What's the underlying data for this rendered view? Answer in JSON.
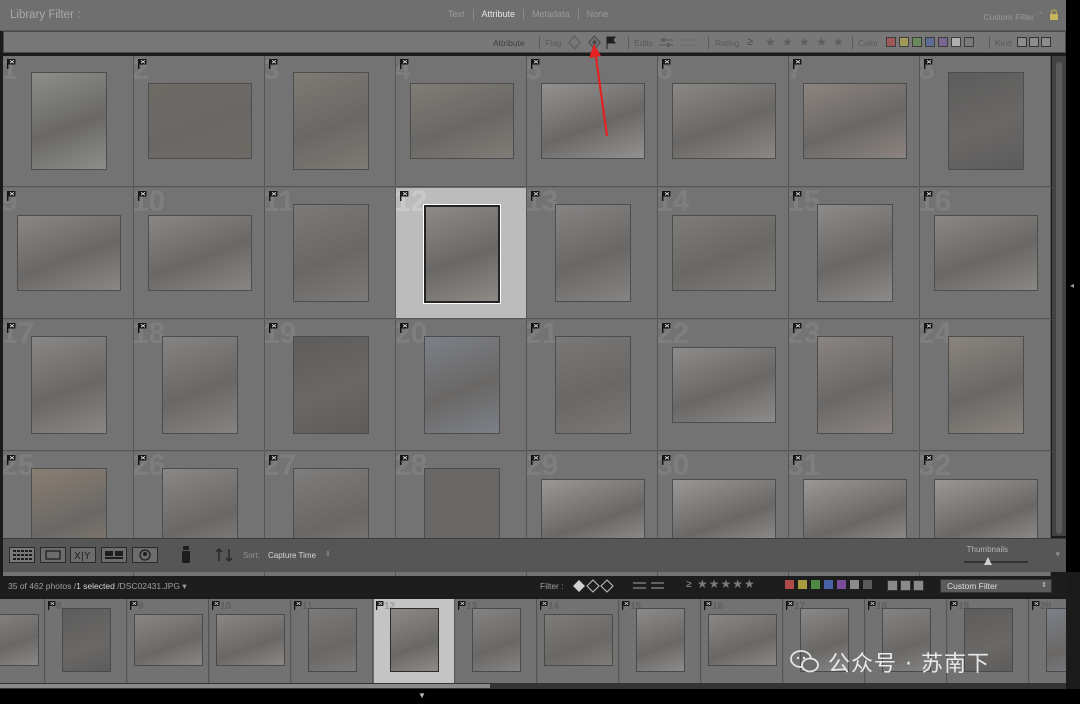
{
  "filter_header": {
    "title": "Library Filter :",
    "tabs": [
      "Text",
      "Attribute",
      "Metadata",
      "None"
    ],
    "active_tab": "Attribute",
    "preset": "Custom Filter",
    "lock_icon": "lock-icon"
  },
  "attribute_bar": {
    "label": "Attribute",
    "flag_label": "Flag",
    "edits_label": "Edits",
    "rating_label": "Rating",
    "rating_op": "≥",
    "color_label": "Color",
    "kind_label": "Kind",
    "colors": [
      "#d05050",
      "#d3c34a",
      "#5aa05a",
      "#5778c4",
      "#9060b4",
      "#e6e6e6",
      "#8a8a8a"
    ]
  },
  "grid": {
    "cells": [
      {
        "n": "1",
        "tone": "#8c8e8a"
      },
      {
        "n": "2",
        "tone": "#6e6a66"
      },
      {
        "n": "3",
        "tone": "#7e7a74"
      },
      {
        "n": "4",
        "tone": "#807c76"
      },
      {
        "n": "5",
        "tone": "#949290"
      },
      {
        "n": "6",
        "tone": "#8a8784"
      },
      {
        "n": "7",
        "tone": "#8c8480"
      },
      {
        "n": "8",
        "tone": "#5c5c5c"
      },
      {
        "n": "9",
        "tone": "#8a8684"
      },
      {
        "n": "10",
        "tone": "#8a8684"
      },
      {
        "n": "11",
        "tone": "#7c7a78"
      },
      {
        "n": "12",
        "tone": "#8e8a86"
      },
      {
        "n": "13",
        "tone": "#858483"
      },
      {
        "n": "14",
        "tone": "#7e7c78"
      },
      {
        "n": "15",
        "tone": "#8c8b8a"
      },
      {
        "n": "16",
        "tone": "#8a8884"
      },
      {
        "n": "17",
        "tone": "#8a8886"
      },
      {
        "n": "18",
        "tone": "#868482"
      },
      {
        "n": "19",
        "tone": "#5e5c5a"
      },
      {
        "n": "20",
        "tone": "#7c8088"
      },
      {
        "n": "21",
        "tone": "#7a7876"
      },
      {
        "n": "22",
        "tone": "#8e8c8a"
      },
      {
        "n": "23",
        "tone": "#8a8482"
      },
      {
        "n": "24",
        "tone": "#8a847e"
      },
      {
        "n": "25",
        "tone": "#8a7e72"
      },
      {
        "n": "26",
        "tone": "#8a8886"
      },
      {
        "n": "27",
        "tone": "#7e7d7c"
      },
      {
        "n": "28",
        "tone": "#6a6866"
      },
      {
        "n": "29",
        "tone": "#9a9896"
      },
      {
        "n": "30",
        "tone": "#9a9896"
      },
      {
        "n": "31",
        "tone": "#9a9896"
      },
      {
        "n": "32",
        "tone": "#9a9896"
      }
    ],
    "selected": "12"
  },
  "toolbar": {
    "sort_label": "Sort:",
    "sort_value": "Capture Time",
    "thumbnails_label": "Thumbnails",
    "view_buttons": [
      "grid-view-icon",
      "loupe-view-icon",
      "compare-view-icon",
      "survey-view-icon",
      "people-view-icon"
    ],
    "spray_icon": "painter-icon",
    "sort_direction_icon": "sort-direction-icon"
  },
  "filmstrip_bar": {
    "count_text": "35 of 462 photos /",
    "selected_text": "1 selected",
    "file_text": "/DSC02431.JPG ▾",
    "filter_label": "Filter :",
    "preset": "Custom Filter"
  },
  "filmstrip": {
    "frames": [
      {
        "n": "",
        "tone": "#8a8886"
      },
      {
        "n": "8",
        "tone": "#5c5c5c"
      },
      {
        "n": "9",
        "tone": "#8a8684"
      },
      {
        "n": "10",
        "tone": "#8a8684"
      },
      {
        "n": "11",
        "tone": "#7c7a78"
      },
      {
        "n": "12",
        "tone": "#8e8a86"
      },
      {
        "n": "13",
        "tone": "#858483"
      },
      {
        "n": "14",
        "tone": "#7e7c78"
      },
      {
        "n": "15",
        "tone": "#8c8b8a"
      },
      {
        "n": "16",
        "tone": "#8a8884"
      },
      {
        "n": "17",
        "tone": "#8a8886"
      },
      {
        "n": "18",
        "tone": "#868482"
      },
      {
        "n": "19",
        "tone": "#5e5c5a"
      },
      {
        "n": "20",
        "tone": "#7c8088"
      }
    ],
    "selected": "12"
  },
  "watermark": {
    "text": "公众号 · 苏南下"
  }
}
